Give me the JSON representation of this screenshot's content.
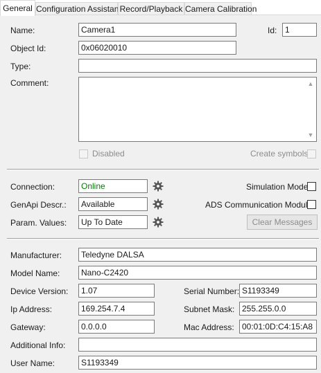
{
  "tabs": [
    {
      "label": "General"
    },
    {
      "label": "Configuration Assistant"
    },
    {
      "label": "Record/Playback"
    },
    {
      "label": "Camera Calibration"
    }
  ],
  "general": {
    "name_label": "Name:",
    "name_value": "Camera1",
    "id_label": "Id:",
    "id_value": "1",
    "object_id_label": "Object Id:",
    "object_id_value": "0x06020010",
    "type_label": "Type:",
    "type_value": "",
    "comment_label": "Comment:",
    "comment_value": "",
    "disabled_label": "Disabled",
    "create_symbols_label": "Create symbols"
  },
  "status": {
    "connection_label": "Connection:",
    "connection_value": "Online",
    "genapi_label": "GenApi Descr.:",
    "genapi_value": "Available",
    "param_label": "Param. Values:",
    "param_value": "Up To Date",
    "simulation_label": "Simulation Mode",
    "ads_label": "ADS Communication Module",
    "clear_button": "Clear Messages"
  },
  "device": {
    "manufacturer_label": "Manufacturer:",
    "manufacturer_value": "Teledyne DALSA",
    "model_label": "Model Name:",
    "model_value": "Nano-C2420",
    "version_label": "Device Version:",
    "version_value": "1.07",
    "serial_label": "Serial Number:",
    "serial_value": "S1193349",
    "ip_label": "Ip Address:",
    "ip_value": "169.254.7.4",
    "subnet_label": "Subnet Mask:",
    "subnet_value": "255.255.0.0",
    "gateway_label": "Gateway:",
    "gateway_value": "0.0.0.0",
    "mac_label": "Mac Address:",
    "mac_value": "00:01:0D:C4:15:A8",
    "additional_label": "Additional Info:",
    "additional_value": "",
    "user_label": "User Name:",
    "user_value": "S1193349"
  },
  "colors": {
    "online_green": "#008000",
    "panel_bg": "#f0f0f0"
  },
  "icons": {
    "gear": "gear-icon",
    "scroll_up": "scroll-up-arrow-icon",
    "scroll_down": "scroll-down-arrow-icon"
  }
}
